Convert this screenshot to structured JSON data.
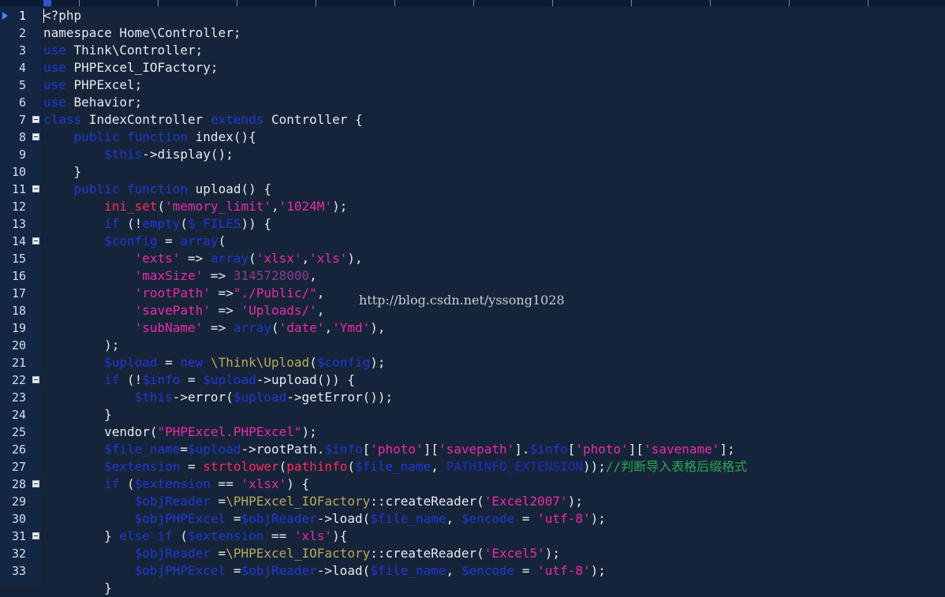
{
  "editor": {
    "language": "php",
    "watermark": "http://blog.csdn.net/yssong1028",
    "colors": {
      "background": "#16243a",
      "gutter": "#132744",
      "keyword": "#1f37d4",
      "string": "#ea2ba5",
      "variable": "#1f37d4",
      "function": "#ff2b57",
      "number": "#8a3a8c",
      "comment": "#2ba64f",
      "constant": "#1e2ec0",
      "namespace": "#b7a95a",
      "text": "#e5e9ef"
    },
    "icons": {
      "current_line": "triangle-marker-icon",
      "fold": "fold-collapse-icon"
    },
    "lines": [
      {
        "n": "1",
        "fold": false,
        "current": true,
        "tokens": [
          [
            "txt",
            "<?php"
          ]
        ]
      },
      {
        "n": "2",
        "fold": false,
        "tokens": [
          [
            "txt",
            "namespace Home\\Controller;"
          ]
        ]
      },
      {
        "n": "3",
        "fold": false,
        "tokens": [
          [
            "kw",
            "use"
          ],
          [
            "txt",
            " Think\\Controller;"
          ]
        ]
      },
      {
        "n": "4",
        "fold": false,
        "tokens": [
          [
            "kw",
            "use"
          ],
          [
            "txt",
            " PHPExcel_IOFactory;"
          ]
        ]
      },
      {
        "n": "5",
        "fold": false,
        "tokens": [
          [
            "kw",
            "use"
          ],
          [
            "txt",
            " PHPExcel;"
          ]
        ]
      },
      {
        "n": "6",
        "fold": false,
        "tokens": [
          [
            "kw",
            "use"
          ],
          [
            "txt",
            " Behavior;"
          ]
        ]
      },
      {
        "n": "7",
        "fold": true,
        "tokens": [
          [
            "kw",
            "class"
          ],
          [
            "txt",
            " IndexController "
          ],
          [
            "kw",
            "extends"
          ],
          [
            "txt",
            " Controller {"
          ]
        ]
      },
      {
        "n": "8",
        "fold": true,
        "tokens": [
          [
            "txt",
            "    "
          ],
          [
            "kw",
            "public"
          ],
          [
            "txt",
            " "
          ],
          [
            "kw",
            "function"
          ],
          [
            "txt",
            " index(){"
          ]
        ]
      },
      {
        "n": "9",
        "fold": false,
        "tokens": [
          [
            "txt",
            "        "
          ],
          [
            "var",
            "$this"
          ],
          [
            "txt",
            "->display();"
          ]
        ]
      },
      {
        "n": "10",
        "fold": false,
        "tokens": [
          [
            "txt",
            "    }"
          ]
        ]
      },
      {
        "n": "11",
        "fold": true,
        "tokens": [
          [
            "txt",
            "    "
          ],
          [
            "kw",
            "public"
          ],
          [
            "txt",
            " "
          ],
          [
            "kw",
            "function"
          ],
          [
            "txt",
            " upload() {"
          ]
        ]
      },
      {
        "n": "12",
        "fold": false,
        "tokens": [
          [
            "txt",
            "        "
          ],
          [
            "fn",
            "ini_set"
          ],
          [
            "txt",
            "("
          ],
          [
            "str",
            "'memory_limit'"
          ],
          [
            "txt",
            ","
          ],
          [
            "str",
            "'1024M'"
          ],
          [
            "txt",
            ");"
          ]
        ]
      },
      {
        "n": "13",
        "fold": false,
        "tokens": [
          [
            "txt",
            "        "
          ],
          [
            "kw",
            "if"
          ],
          [
            "txt",
            " (!"
          ],
          [
            "kw",
            "empty"
          ],
          [
            "txt",
            "("
          ],
          [
            "var",
            "$_FILES"
          ],
          [
            "txt",
            ")) {"
          ]
        ]
      },
      {
        "n": "14",
        "fold": true,
        "tokens": [
          [
            "txt",
            "        "
          ],
          [
            "var",
            "$config"
          ],
          [
            "txt",
            " = "
          ],
          [
            "kw",
            "array"
          ],
          [
            "txt",
            "("
          ]
        ]
      },
      {
        "n": "15",
        "fold": false,
        "tokens": [
          [
            "txt",
            "            "
          ],
          [
            "str",
            "'exts'"
          ],
          [
            "txt",
            " => "
          ],
          [
            "kw",
            "array"
          ],
          [
            "txt",
            "("
          ],
          [
            "str",
            "'xlsx'"
          ],
          [
            "txt",
            ","
          ],
          [
            "str",
            "'xls'"
          ],
          [
            "txt",
            "),"
          ]
        ]
      },
      {
        "n": "16",
        "fold": false,
        "tokens": [
          [
            "txt",
            "            "
          ],
          [
            "str",
            "'maxSize'"
          ],
          [
            "txt",
            " => "
          ],
          [
            "num",
            "3145728000"
          ],
          [
            "txt",
            ","
          ]
        ]
      },
      {
        "n": "17",
        "fold": false,
        "tokens": [
          [
            "txt",
            "            "
          ],
          [
            "str",
            "'rootPath'"
          ],
          [
            "txt",
            " =>"
          ],
          [
            "str",
            "\"./Public/\""
          ],
          [
            "txt",
            ","
          ]
        ]
      },
      {
        "n": "18",
        "fold": false,
        "tokens": [
          [
            "txt",
            "            "
          ],
          [
            "str",
            "'savePath'"
          ],
          [
            "txt",
            " => "
          ],
          [
            "str",
            "'Uploads/'"
          ],
          [
            "txt",
            ","
          ]
        ]
      },
      {
        "n": "19",
        "fold": false,
        "tokens": [
          [
            "txt",
            "            "
          ],
          [
            "str",
            "'subName'"
          ],
          [
            "txt",
            " => "
          ],
          [
            "kw",
            "array"
          ],
          [
            "txt",
            "("
          ],
          [
            "str",
            "'date'"
          ],
          [
            "txt",
            ","
          ],
          [
            "str",
            "'Ymd'"
          ],
          [
            "txt",
            "),"
          ]
        ]
      },
      {
        "n": "20",
        "fold": false,
        "tokens": [
          [
            "txt",
            "        );"
          ]
        ]
      },
      {
        "n": "21",
        "fold": false,
        "tokens": [
          [
            "txt",
            "        "
          ],
          [
            "var",
            "$upload"
          ],
          [
            "txt",
            " = "
          ],
          [
            "kw",
            "new"
          ],
          [
            "txt",
            " "
          ],
          [
            "ns",
            "\\Think\\Upload"
          ],
          [
            "txt",
            "("
          ],
          [
            "var",
            "$config"
          ],
          [
            "txt",
            ");"
          ]
        ]
      },
      {
        "n": "22",
        "fold": true,
        "tokens": [
          [
            "txt",
            "        "
          ],
          [
            "kw",
            "if"
          ],
          [
            "txt",
            " (!"
          ],
          [
            "var",
            "$info"
          ],
          [
            "txt",
            " = "
          ],
          [
            "var",
            "$upload"
          ],
          [
            "txt",
            "->upload()) {"
          ]
        ]
      },
      {
        "n": "23",
        "fold": false,
        "tokens": [
          [
            "txt",
            "            "
          ],
          [
            "var",
            "$this"
          ],
          [
            "txt",
            "->error("
          ],
          [
            "var",
            "$upload"
          ],
          [
            "txt",
            "->getError());"
          ]
        ]
      },
      {
        "n": "24",
        "fold": false,
        "tokens": [
          [
            "txt",
            "        }"
          ]
        ]
      },
      {
        "n": "25",
        "fold": false,
        "tokens": [
          [
            "txt",
            "        vendor("
          ],
          [
            "str",
            "\"PHPExcel.PHPExcel\""
          ],
          [
            "txt",
            ");"
          ]
        ]
      },
      {
        "n": "26",
        "fold": false,
        "tokens": [
          [
            "txt",
            "        "
          ],
          [
            "var",
            "$file_name"
          ],
          [
            "txt",
            "="
          ],
          [
            "var",
            "$upload"
          ],
          [
            "txt",
            "->rootPath."
          ],
          [
            "var",
            "$info"
          ],
          [
            "txt",
            "["
          ],
          [
            "str",
            "'photo'"
          ],
          [
            "txt",
            "]["
          ],
          [
            "str",
            "'savepath'"
          ],
          [
            "txt",
            "]."
          ],
          [
            "var",
            "$info"
          ],
          [
            "txt",
            "["
          ],
          [
            "str",
            "'photo'"
          ],
          [
            "txt",
            "]["
          ],
          [
            "str",
            "'savename'"
          ],
          [
            "txt",
            "];"
          ]
        ]
      },
      {
        "n": "27",
        "fold": false,
        "tokens": [
          [
            "txt",
            "        "
          ],
          [
            "var",
            "$extension"
          ],
          [
            "txt",
            " = "
          ],
          [
            "fn",
            "strtolower"
          ],
          [
            "txt",
            "("
          ],
          [
            "fn",
            "pathinfo"
          ],
          [
            "txt",
            "("
          ],
          [
            "var",
            "$file_name"
          ],
          [
            "txt",
            ", "
          ],
          [
            "const",
            "PATHINFO_EXTENSION"
          ],
          [
            "txt",
            "));"
          ],
          [
            "cmt",
            "//判断导入表格后缀格式"
          ]
        ]
      },
      {
        "n": "28",
        "fold": true,
        "tokens": [
          [
            "txt",
            "        "
          ],
          [
            "kw",
            "if"
          ],
          [
            "txt",
            " ("
          ],
          [
            "var",
            "$extension"
          ],
          [
            "txt",
            " == "
          ],
          [
            "str",
            "'xlsx'"
          ],
          [
            "txt",
            ") {"
          ]
        ]
      },
      {
        "n": "29",
        "fold": false,
        "tokens": [
          [
            "txt",
            "            "
          ],
          [
            "var",
            "$objReader"
          ],
          [
            "txt",
            " ="
          ],
          [
            "ns",
            "\\PHPExcel_IOFactory"
          ],
          [
            "txt",
            "::createReader("
          ],
          [
            "str",
            "'Excel2007'"
          ],
          [
            "txt",
            ");"
          ]
        ]
      },
      {
        "n": "30",
        "fold": false,
        "tokens": [
          [
            "txt",
            "            "
          ],
          [
            "var",
            "$objPHPExcel"
          ],
          [
            "txt",
            " ="
          ],
          [
            "var",
            "$objReader"
          ],
          [
            "txt",
            "->load("
          ],
          [
            "var",
            "$file_name"
          ],
          [
            "txt",
            ", "
          ],
          [
            "var",
            "$encode"
          ],
          [
            "txt",
            " = "
          ],
          [
            "str",
            "'utf-8'"
          ],
          [
            "txt",
            ");"
          ]
        ]
      },
      {
        "n": "31",
        "fold": true,
        "tokens": [
          [
            "txt",
            "        } "
          ],
          [
            "kw",
            "else if"
          ],
          [
            "txt",
            " ("
          ],
          [
            "var",
            "$extension"
          ],
          [
            "txt",
            " == "
          ],
          [
            "str",
            "'xls'"
          ],
          [
            "txt",
            "){"
          ]
        ]
      },
      {
        "n": "32",
        "fold": false,
        "tokens": [
          [
            "txt",
            "            "
          ],
          [
            "var",
            "$objReader"
          ],
          [
            "txt",
            " ="
          ],
          [
            "ns",
            "\\PHPExcel_IOFactory"
          ],
          [
            "txt",
            "::createReader("
          ],
          [
            "str",
            "'Excel5'"
          ],
          [
            "txt",
            ");"
          ]
        ]
      },
      {
        "n": "33",
        "fold": false,
        "tokens": [
          [
            "txt",
            "            "
          ],
          [
            "var",
            "$objPHPExcel"
          ],
          [
            "txt",
            " ="
          ],
          [
            "var",
            "$objReader"
          ],
          [
            "txt",
            "->load("
          ],
          [
            "var",
            "$file_name"
          ],
          [
            "txt",
            ", "
          ],
          [
            "var",
            "$encode"
          ],
          [
            "txt",
            " = "
          ],
          [
            "str",
            "'utf-8'"
          ],
          [
            "txt",
            ");"
          ]
        ]
      },
      {
        "n": "",
        "fold": false,
        "tokens": [
          [
            "txt",
            "        }"
          ]
        ]
      }
    ]
  }
}
